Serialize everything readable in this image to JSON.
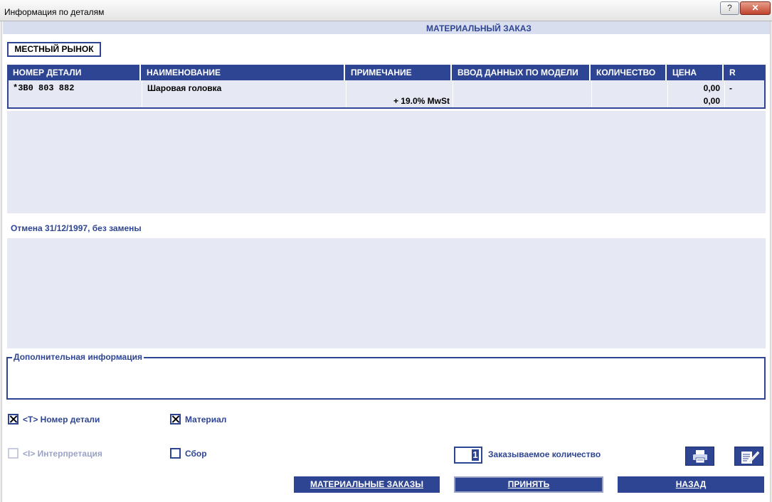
{
  "window": {
    "title": "Информация по деталям",
    "help_label": "?",
    "close_label": "✕"
  },
  "header": {
    "title": "МАТЕРИАЛЬНЫЙ ЗАКАЗ"
  },
  "market_button": "МЕСТНЫЙ РЫНОК",
  "table": {
    "columns": [
      "НОМЕР ДЕТАЛИ",
      "НАИМЕНОВАНИЕ",
      "ПРИМЕЧАНИЕ",
      "ВВОД ДАННЫХ ПО МОДЕЛИ",
      "КОЛИЧЕСТВО",
      "ЦЕНА",
      "R"
    ],
    "rows": [
      {
        "part_number": "*3B0 803 882",
        "name": "Шаровая головка",
        "note": "+ 19.0% MwSt",
        "model_input": "",
        "quantity": "",
        "price": "0,00",
        "price_tax": "0,00",
        "r": "-"
      }
    ]
  },
  "cancellation_note": "Отмена 31/12/1997, без замены",
  "additional_info": {
    "label": "Дополнительная информация"
  },
  "checkboxes": {
    "part_number": {
      "label": "<T> Номер детали",
      "checked": true
    },
    "material": {
      "label": "Материал",
      "checked": true
    },
    "interpretation": {
      "label": "<I> Интерпретация",
      "checked": false
    },
    "assembly": {
      "label": "Сбор",
      "checked": false
    }
  },
  "order_quantity": {
    "value": "1",
    "label": "Заказываемое количество"
  },
  "icons": {
    "print": "printer-icon",
    "edit": "edit-notes-icon"
  },
  "buttons": {
    "material_orders": "МАТЕРИАЛЬНЫЕ ЗАКАЗЫ",
    "accept": "ПРИНЯТЬ",
    "back": "НАЗАД"
  }
}
